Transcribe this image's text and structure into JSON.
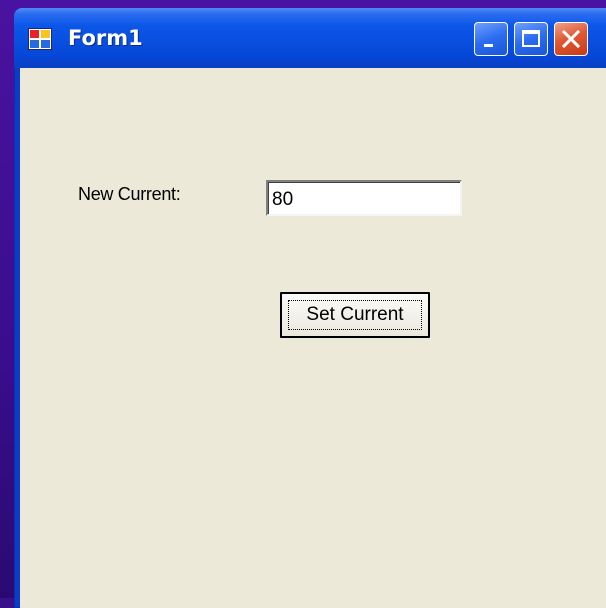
{
  "window": {
    "title": "Form1",
    "icon": "form-app-icon",
    "controls": {
      "minimize_icon": "minimize-icon",
      "maximize_icon": "maximize-icon",
      "close_icon": "close-icon"
    }
  },
  "form": {
    "current_label": "New Current:",
    "current_value": "80",
    "set_button_label": "Set Current"
  },
  "colors": {
    "titlebar": "#0a4fe0",
    "client_background": "#ece9d8",
    "close_button": "#e05a35",
    "desktop": "#3a0f8a"
  }
}
